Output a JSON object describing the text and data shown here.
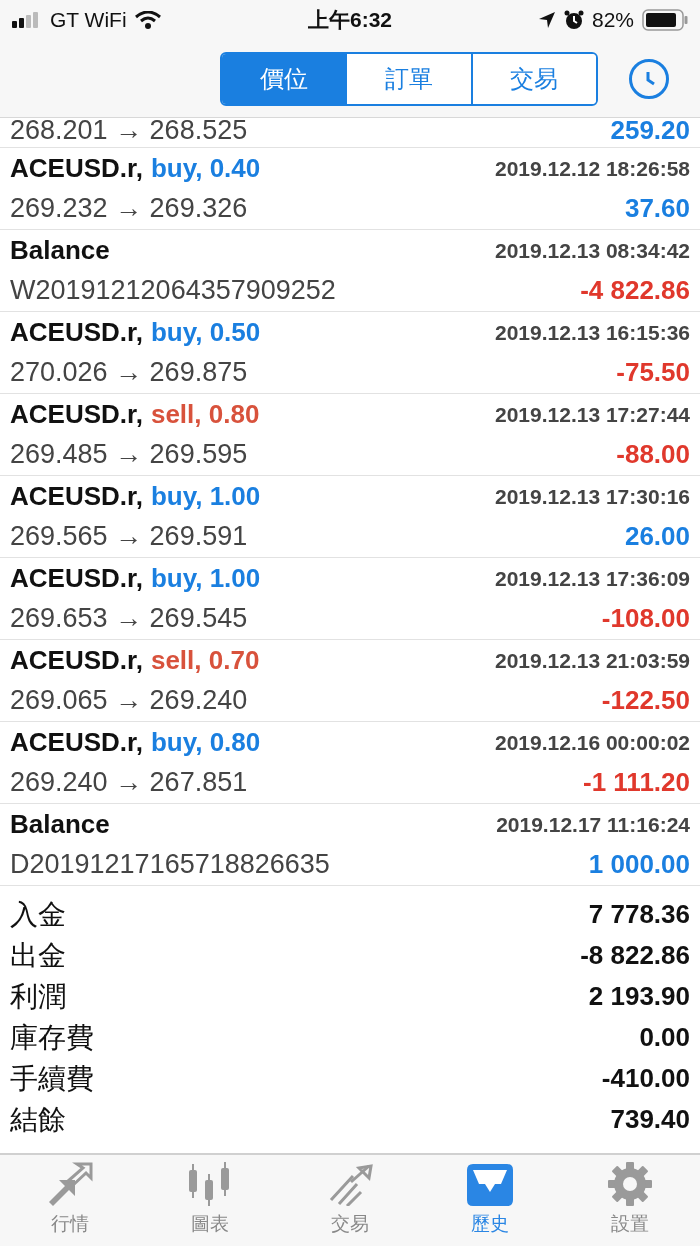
{
  "status_bar": {
    "carrier": "GT WiFi",
    "time": "上午6:32",
    "battery": "82%"
  },
  "segments": [
    {
      "label": "價位",
      "selected": true
    },
    {
      "label": "訂單",
      "selected": false
    },
    {
      "label": "交易",
      "selected": false
    }
  ],
  "partial_row": {
    "prices": "268.201 → 268.525",
    "profit": "259.20",
    "loss": false
  },
  "deals": [
    {
      "kind": "trade",
      "symbol": "ACEUSD.r,",
      "sell": false,
      "action": "buy, 0.40",
      "time": "2019.12.12 18:26:58",
      "detail": "269.232 → 269.326",
      "profit": "37.60",
      "loss": false
    },
    {
      "kind": "balance",
      "symbol": "Balance",
      "time": "2019.12.13 08:34:42",
      "detail": "W20191212064357909252",
      "profit": "-4 822.86",
      "loss": true
    },
    {
      "kind": "trade",
      "symbol": "ACEUSD.r,",
      "sell": false,
      "action": "buy, 0.50",
      "time": "2019.12.13 16:15:36",
      "detail": "270.026 → 269.875",
      "profit": "-75.50",
      "loss": true
    },
    {
      "kind": "trade",
      "symbol": "ACEUSD.r,",
      "sell": true,
      "action": "sell, 0.80",
      "time": "2019.12.13 17:27:44",
      "detail": "269.485 → 269.595",
      "profit": "-88.00",
      "loss": true
    },
    {
      "kind": "trade",
      "symbol": "ACEUSD.r,",
      "sell": false,
      "action": "buy, 1.00",
      "time": "2019.12.13 17:30:16",
      "detail": "269.565 → 269.591",
      "profit": "26.00",
      "loss": false
    },
    {
      "kind": "trade",
      "symbol": "ACEUSD.r,",
      "sell": false,
      "action": "buy, 1.00",
      "time": "2019.12.13 17:36:09",
      "detail": "269.653 → 269.545",
      "profit": "-108.00",
      "loss": true
    },
    {
      "kind": "trade",
      "symbol": "ACEUSD.r,",
      "sell": true,
      "action": "sell, 0.70",
      "time": "2019.12.13 21:03:59",
      "detail": "269.065 → 269.240",
      "profit": "-122.50",
      "loss": true
    },
    {
      "kind": "trade",
      "symbol": "ACEUSD.r,",
      "sell": false,
      "action": "buy, 0.80",
      "time": "2019.12.16 00:00:02",
      "detail": "269.240 → 267.851",
      "profit": "-1 111.20",
      "loss": true
    },
    {
      "kind": "balance",
      "symbol": "Balance",
      "time": "2019.12.17 11:16:24",
      "detail": "D20191217165718826635",
      "profit": "1 000.00",
      "loss": false
    }
  ],
  "summary": [
    {
      "label": "入金",
      "value": "7 778.36"
    },
    {
      "label": "出金",
      "value": "-8 822.86"
    },
    {
      "label": "利潤",
      "value": "2 193.90"
    },
    {
      "label": "庫存費",
      "value": "0.00"
    },
    {
      "label": "手續費",
      "value": "-410.00"
    },
    {
      "label": "結餘",
      "value": "739.40"
    }
  ],
  "tab_bar": [
    {
      "label": "行情",
      "selected": false
    },
    {
      "label": "圖表",
      "selected": false
    },
    {
      "label": "交易",
      "selected": false
    },
    {
      "label": "歷史",
      "selected": true
    },
    {
      "label": "設置",
      "selected": false
    }
  ]
}
